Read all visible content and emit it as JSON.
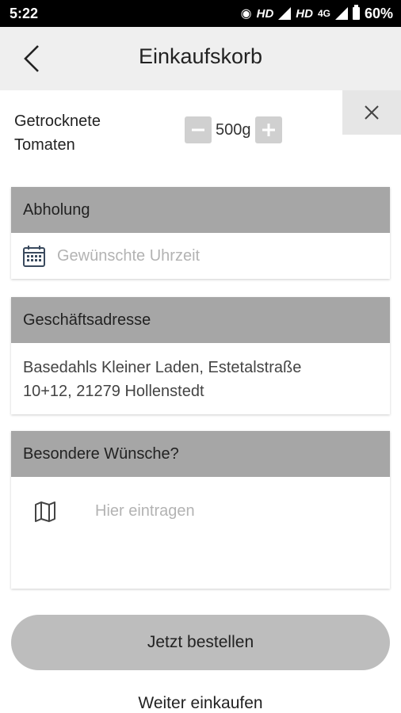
{
  "status_bar": {
    "time": "5:22",
    "network1": "HD",
    "network2": "HD",
    "network_type": "4G",
    "battery": "60%"
  },
  "app_bar": {
    "title": "Einkaufskorb",
    "back_icon": "chevron-left-icon"
  },
  "cart_item": {
    "name_line1": "Getrocknete",
    "name_line2": "Tomaten",
    "quantity": "500g",
    "remove_icon": "close-icon"
  },
  "pickup": {
    "header": "Abholung",
    "time_placeholder": "Gewünschte Uhrzeit",
    "icon": "calendar-icon"
  },
  "address": {
    "header": "Geschäftsadresse",
    "line1": "Basedahls Kleiner Laden, Estetalstraße",
    "line2": "10+12, 21279 Hollenstedt"
  },
  "wishes": {
    "header": "Besondere Wünsche?",
    "placeholder": "Hier eintragen",
    "icon": "map-icon"
  },
  "actions": {
    "order_button": "Jetzt bestellen",
    "continue_link": "Weiter einkaufen"
  },
  "colors": {
    "header_gray": "#a6a6a6",
    "appbar_bg": "#efefef",
    "button_gray": "#bdbdbd"
  }
}
